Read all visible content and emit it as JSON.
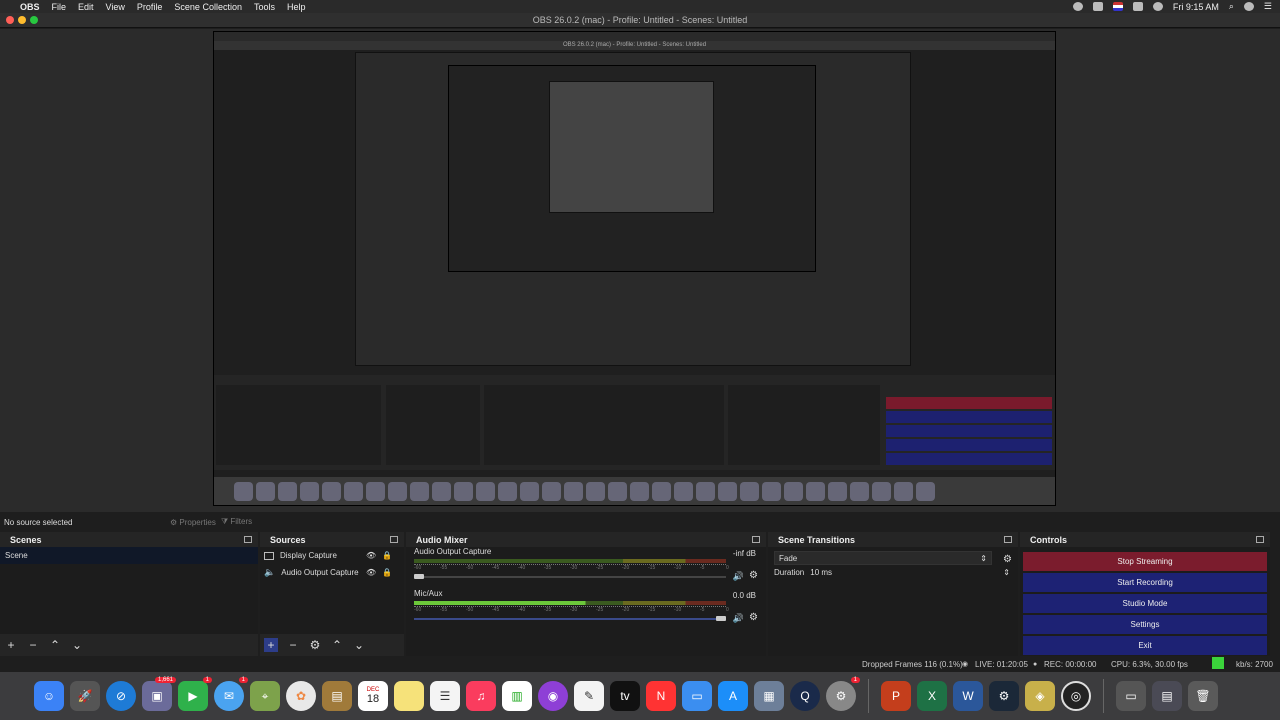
{
  "menubar": {
    "items": [
      "OBS",
      "File",
      "Edit",
      "View",
      "Profile",
      "Scene Collection",
      "Tools",
      "Help"
    ],
    "clock": "Fri 9:15 AM"
  },
  "window": {
    "title": "OBS 26.0.2 (mac) - Profile: Untitled - Scenes: Untitled"
  },
  "properties_bar": {
    "selection": "No source selected",
    "properties_label": "Properties",
    "filters_label": "Filters"
  },
  "scenes": {
    "title": "Scenes",
    "items": [
      {
        "label": "Scene",
        "selected": true
      }
    ]
  },
  "sources": {
    "title": "Sources",
    "items": [
      {
        "label": "Display Capture",
        "icon": "monitor-icon"
      },
      {
        "label": "Audio Output Capture",
        "icon": "speaker-icon"
      }
    ]
  },
  "mixer": {
    "title": "Audio Mixer",
    "channels": [
      {
        "name": "Audio Output Capture",
        "db": "-inf dB",
        "volume": 0.0
      },
      {
        "name": "Mic/Aux",
        "db": "0.0 dB",
        "volume": 1.0
      }
    ],
    "scale": [
      "-60",
      "-55",
      "-50",
      "-45",
      "-40",
      "-35",
      "-30",
      "-25",
      "-20",
      "-15",
      "-10",
      "-5",
      "0"
    ]
  },
  "transitions": {
    "title": "Scene Transitions",
    "selected": "Fade",
    "duration_label": "Duration",
    "duration_value": "10 ms"
  },
  "controls": {
    "title": "Controls",
    "buttons": [
      "Stop Streaming",
      "Start Recording",
      "Studio Mode",
      "Settings",
      "Exit"
    ]
  },
  "status": {
    "dropped": "Dropped Frames 116 (0.1%)",
    "live": "LIVE: 01:20:05",
    "rec": "REC: 00:00:00",
    "cpu": "CPU: 6.3%, 30.00 fps",
    "kbps": "kb/s: 2700"
  },
  "dock_badges": {
    "photos": "1,661",
    "facetime": "1",
    "messages": "1",
    "settings": "1"
  },
  "calendar": {
    "month": "DEC",
    "day": "18"
  },
  "colors": {
    "stop_streaming": "#7b1c2d",
    "control_button": "#1d2274",
    "selection": "#101828",
    "health": "#3bd43b"
  }
}
